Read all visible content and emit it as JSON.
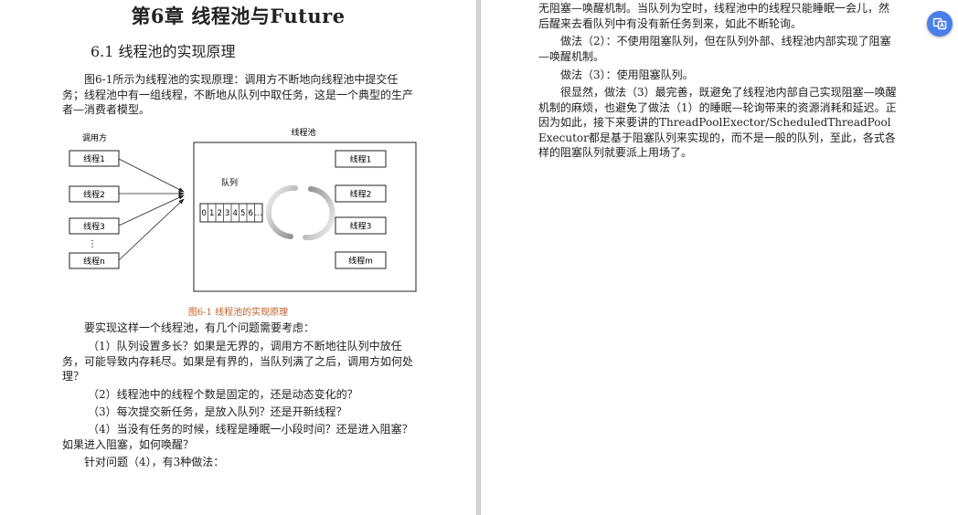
{
  "left_page": {
    "chapter_title": "第6章 线程池与Future",
    "section_title": "6.1  线程池的实现原理",
    "intro_para": "图6-1所示为线程池的实现原理：调用方不断地向线程池中提交任务；线程池中有一组线程，不断地从队列中取任务，这是一个典型的生产者—消费者模型。",
    "diagram": {
      "caller_label": "调用方",
      "pool_label": "线程池",
      "queue_label": "队列",
      "caller_threads": [
        "线程1",
        "线程2",
        "线程3",
        "线程n"
      ],
      "pool_threads": [
        "线程1",
        "线程2",
        "线程3",
        "线程m"
      ],
      "queue_cells": [
        "0",
        "1",
        "2",
        "3",
        "4",
        "5",
        "6",
        "…"
      ],
      "vertical_dots": "⋮"
    },
    "caption": "图6-1  线程池的实现原理",
    "questions_intro": "要实现这样一个线程池，有几个问题需要考虑：",
    "q1": "（1）队列设置多长？如果是无界的，调用方不断地往队列中放任务，可能导致内存耗尽。如果是有界的，当队列满了之后，调用方如何处理？",
    "q2": "（2）线程池中的线程个数是固定的，还是动态变化的？",
    "q3": "（3）每次提交新任务，是放入队列？还是开新线程？",
    "q4": "（4）当没有任务的时候，线程是睡眠一小段时间？还是进入阻塞？如果进入阻塞，如何唤醒？",
    "approach_intro": "针对问题（4），有3种做法："
  },
  "right_page": {
    "cont_para": "无阻塞—唤醒机制。当队列为空时，线程池中的线程只能睡眠一会儿，然后醒来去看队列中有没有新任务到来，如此不断轮询。",
    "approach2": "做法（2）：不使用阻塞队列，但在队列外部、线程池内部实现了阻塞—唤醒机制。",
    "approach3": "做法（3）：使用阻塞队列。",
    "conclusion": "很显然，做法（3）最完善，既避免了线程池内部自己实现阻塞—唤醒机制的麻烦，也避免了做法（1）的睡眠—轮询带来的资源消耗和延迟。正因为如此，接下来要讲的ThreadPoolExector/ScheduledThreadPoolExecutor都是基于阻塞队列来实现的，而不是一般的队列，至此，各式各样的阻塞队列就要派上用场了。"
  },
  "ui": {
    "float_button_icon": "translate-icon",
    "accent_color": "#4a7ee8",
    "caption_color": "#c0612b"
  }
}
